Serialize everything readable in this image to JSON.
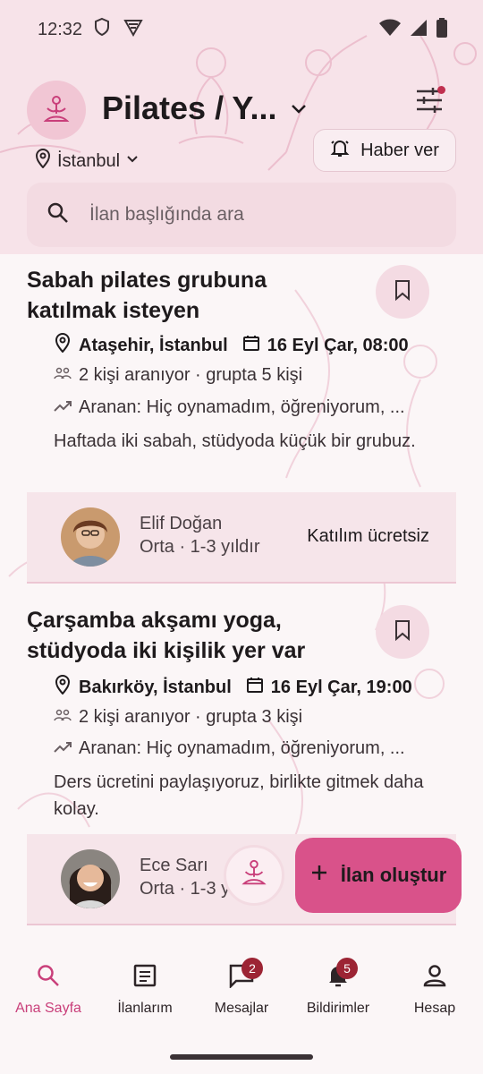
{
  "status_bar": {
    "time": "12:32"
  },
  "header": {
    "title": "Pilates / Y...",
    "location": "İstanbul",
    "alert_button": "Haber ver",
    "search_placeholder": "İlan başlığında ara"
  },
  "listings": [
    {
      "title": "Sabah pilates grubuna katılmak isteyen",
      "place": "Ataşehir, İstanbul",
      "date": "16 Eyl Çar, 08:00",
      "people": "2 kişi aranıyor · grupta 5 kişi",
      "level": "Aranan: Hiç oynamadım, öğreniyorum, ...",
      "description": "Haftada iki sabah, stüdyoda küçük bir grubuz.",
      "host_name": "Elif Doğan",
      "host_level": "Orta · 1-3 yıldır",
      "fee": "Katılım ücretsiz"
    },
    {
      "title": "Çarşamba akşamı yoga, stüdyoda iki kişilik yer var",
      "place": "Bakırköy, İstanbul",
      "date": "16 Eyl Çar, 19:00",
      "people": "2 kişi aranıyor · grupta 3 kişi",
      "level": "Aranan: Hiç oynamadım, öğreniyorum, ...",
      "description": "Ders ücretini paylaşıyoruz, birlikte gitmek daha kolay.",
      "host_name": "Ece Sarı",
      "host_level": "Orta · 1-3 y"
    }
  ],
  "fab": {
    "label": "İlan oluştur"
  },
  "nav": {
    "home": "Ana Sayfa",
    "listings": "İlanlarım",
    "messages": "Mesajlar",
    "messages_badge": "2",
    "notifications": "Bildirimler",
    "notifications_badge": "5",
    "account": "Hesap"
  },
  "colors": {
    "accent": "#d9528a",
    "header_bg": "#f7e3e9",
    "badge": "#9c2434"
  }
}
